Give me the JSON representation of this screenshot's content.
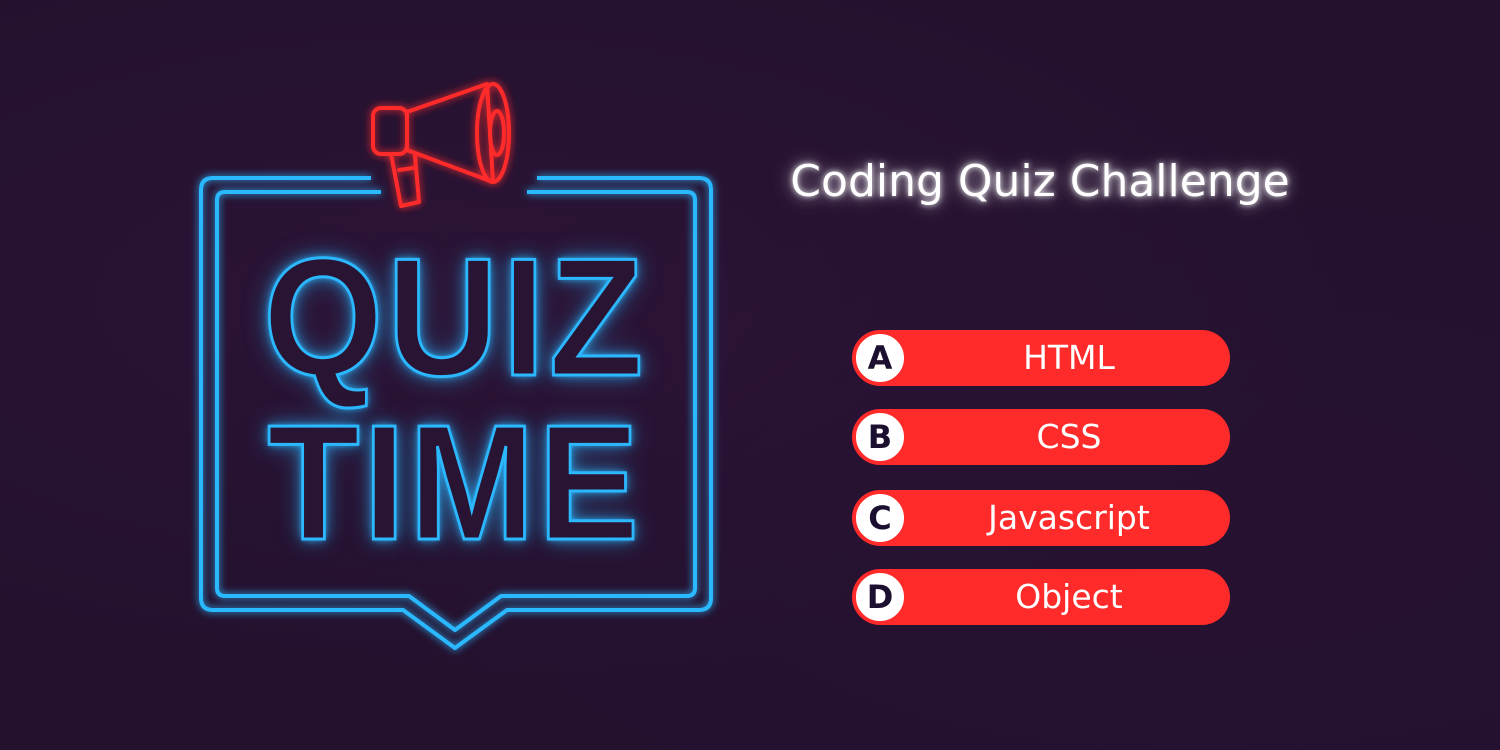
{
  "theme": {
    "background": "#23112e",
    "neon_blue": "#2bb8ff",
    "neon_red": "#ff2b2b",
    "option_red": "#ff2a2a",
    "letter_text": "#1c1030"
  },
  "art": {
    "line1": "QUIZ",
    "line2": "TIME",
    "icon": "megaphone-icon"
  },
  "title": "Coding Quiz Challenge",
  "options": [
    {
      "letter": "A",
      "label": "HTML"
    },
    {
      "letter": "B",
      "label": "CSS"
    },
    {
      "letter": "C",
      "label": "Javascript"
    },
    {
      "letter": "D",
      "label": "Object"
    }
  ]
}
